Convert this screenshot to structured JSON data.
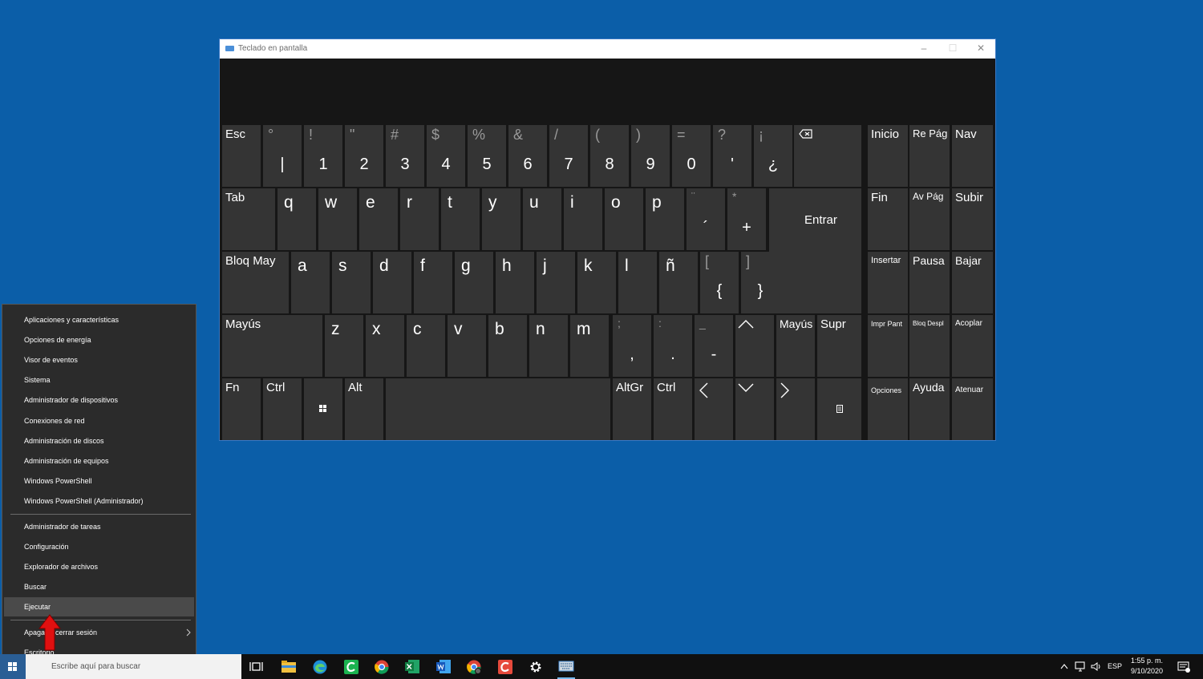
{
  "window": {
    "title": "Teclado en pantalla",
    "minimize": "–",
    "maximize": "☐",
    "close": "✕"
  },
  "keys": {
    "esc": "Esc",
    "num_row": [
      {
        "top": "°",
        "bottom": "|"
      },
      {
        "top": "!",
        "bottom": "1"
      },
      {
        "top": "\"",
        "bottom": "2"
      },
      {
        "top": "#",
        "bottom": "3"
      },
      {
        "top": "$",
        "bottom": "4"
      },
      {
        "top": "%",
        "bottom": "5"
      },
      {
        "top": "&",
        "bottom": "6"
      },
      {
        "top": "/",
        "bottom": "7"
      },
      {
        "top": "(",
        "bottom": "8"
      },
      {
        "top": ")",
        "bottom": "9"
      },
      {
        "top": "=",
        "bottom": "0"
      },
      {
        "top": "?",
        "bottom": "'"
      },
      {
        "top": "¡",
        "bottom": "¿"
      }
    ],
    "tab": "Tab",
    "row_q": [
      "q",
      "w",
      "e",
      "r",
      "t",
      "y",
      "u",
      "i",
      "o",
      "p"
    ],
    "acute": {
      "top": "¨",
      "bottom": "´"
    },
    "plus": {
      "top": "*",
      "bottom": "+"
    },
    "enter": "Entrar",
    "caps": "Bloq May",
    "row_a": [
      "a",
      "s",
      "d",
      "f",
      "g",
      "h",
      "j",
      "k",
      "l",
      "ñ"
    ],
    "brace_open": {
      "top": "[",
      "bottom": "{"
    },
    "brace_close": {
      "top": "]",
      "bottom": "}"
    },
    "shift": "Mayús",
    "row_z": [
      "z",
      "x",
      "c",
      "v",
      "b",
      "n",
      "m"
    ],
    "comma": {
      "top": ";",
      "bottom": ","
    },
    "period": {
      "top": ":",
      "bottom": "."
    },
    "dash": {
      "top": "_",
      "bottom": "-"
    },
    "shift_right": "Mayús",
    "supr": "Supr",
    "fn": "Fn",
    "ctrl": "Ctrl",
    "alt": "Alt",
    "altgr": "AltGr",
    "ctrl_right": "Ctrl",
    "nav": {
      "inicio": "Inicio",
      "re_pag": "Re Pág",
      "nav": "Nav",
      "fin": "Fin",
      "av_pag": "Av Pág",
      "subir": "Subir",
      "insertar": "Insertar",
      "pausa": "Pausa",
      "bajar": "Bajar",
      "impr_pant": "Impr Pant",
      "bloq_despl": "Bloq Despl",
      "acoplar": "Acoplar",
      "opciones": "Opciones",
      "ayuda": "Ayuda",
      "atenuar": "Atenuar"
    }
  },
  "context_menu": {
    "group1": [
      "Aplicaciones y características",
      "Opciones de energía",
      "Visor de eventos",
      "Sistema",
      "Administrador de dispositivos",
      "Conexiones de red",
      "Administración de discos",
      "Administración de equipos",
      "Windows PowerShell",
      "Windows PowerShell (Administrador)"
    ],
    "group2": [
      "Administrador de tareas",
      "Configuración",
      "Explorador de archivos",
      "Buscar",
      "Ejecutar"
    ],
    "group3": [
      "Apagar o cerrar sesión",
      "Escritorio"
    ]
  },
  "taskbar": {
    "search_placeholder": "Escribe aquí para buscar",
    "language": "ESP",
    "time": "1:55 p. m.",
    "date": "9/10/2020"
  },
  "colors": {
    "desktop": "#0b5ea8",
    "key": "#343434",
    "osk_bg": "#161616",
    "menu": "#2b2b2b",
    "arrow": "#e01010"
  }
}
